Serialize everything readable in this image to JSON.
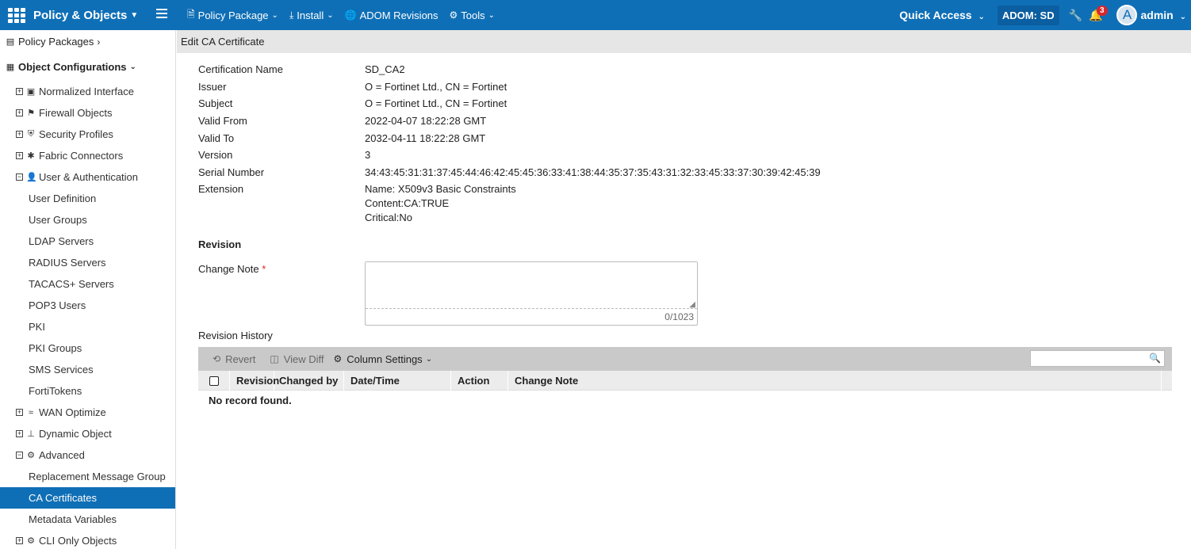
{
  "topbar": {
    "app_title": "Policy & Objects",
    "nav": [
      {
        "label": "Policy Package",
        "icon": "document-icon"
      },
      {
        "label": "Install",
        "icon": "download-icon"
      },
      {
        "label": "ADOM Revisions",
        "icon": "globe-icon"
      },
      {
        "label": "Tools",
        "icon": "gear-icon"
      }
    ],
    "quick_access": "Quick Access",
    "adom": "ADOM: SD",
    "notification_count": "3",
    "avatar_letter": "A",
    "user": "admin"
  },
  "sidebar": {
    "policy_packages": "Policy Packages",
    "object_configurations": "Object Configurations",
    "items": [
      {
        "label": "Normalized Interface"
      },
      {
        "label": "Firewall Objects"
      },
      {
        "label": "Security Profiles"
      },
      {
        "label": "Fabric Connectors"
      },
      {
        "label": "User & Authentication"
      },
      {
        "label": "User Definition"
      },
      {
        "label": "User Groups"
      },
      {
        "label": "LDAP Servers"
      },
      {
        "label": "RADIUS Servers"
      },
      {
        "label": "TACACS+ Servers"
      },
      {
        "label": "POP3 Users"
      },
      {
        "label": "PKI"
      },
      {
        "label": "PKI Groups"
      },
      {
        "label": "SMS Services"
      },
      {
        "label": "FortiTokens"
      },
      {
        "label": "WAN Optimize"
      },
      {
        "label": "Dynamic Object"
      },
      {
        "label": "Advanced"
      },
      {
        "label": "Replacement Message Group"
      },
      {
        "label": "CA Certificates"
      },
      {
        "label": "Metadata Variables"
      },
      {
        "label": "CLI Only Objects"
      }
    ]
  },
  "main": {
    "title": "Edit CA Certificate",
    "fields": [
      {
        "label": "Certification Name",
        "value": "SD_CA2"
      },
      {
        "label": "Issuer",
        "value": "O = Fortinet Ltd., CN = Fortinet"
      },
      {
        "label": "Subject",
        "value": "O = Fortinet Ltd., CN = Fortinet"
      },
      {
        "label": "Valid From",
        "value": "2022-04-07 18:22:28 GMT"
      },
      {
        "label": "Valid To",
        "value": "2032-04-11 18:22:28 GMT"
      },
      {
        "label": "Version",
        "value": "3"
      },
      {
        "label": "Serial Number",
        "value": "34:43:45:31:31:37:45:44:46:42:45:45:36:33:41:38:44:35:37:35:43:31:32:33:45:33:37:30:39:42:45:39"
      }
    ],
    "extension_label": "Extension",
    "extension_lines": [
      "Name: X509v3 Basic Constraints",
      "Content:CA:TRUE",
      "Critical:No"
    ],
    "revision_heading": "Revision",
    "change_note_label": "Change Note",
    "required_mark": "*",
    "change_note_value": "",
    "change_note_counter": "0/1023",
    "revision_history_label": "Revision History",
    "toolbar": {
      "revert": "Revert",
      "view_diff": "View Diff",
      "column_settings": "Column Settings"
    },
    "search_placeholder": "",
    "columns": [
      "Revision",
      "Changed by",
      "Date/Time",
      "Action",
      "Change Note"
    ],
    "no_record": "No record found."
  }
}
